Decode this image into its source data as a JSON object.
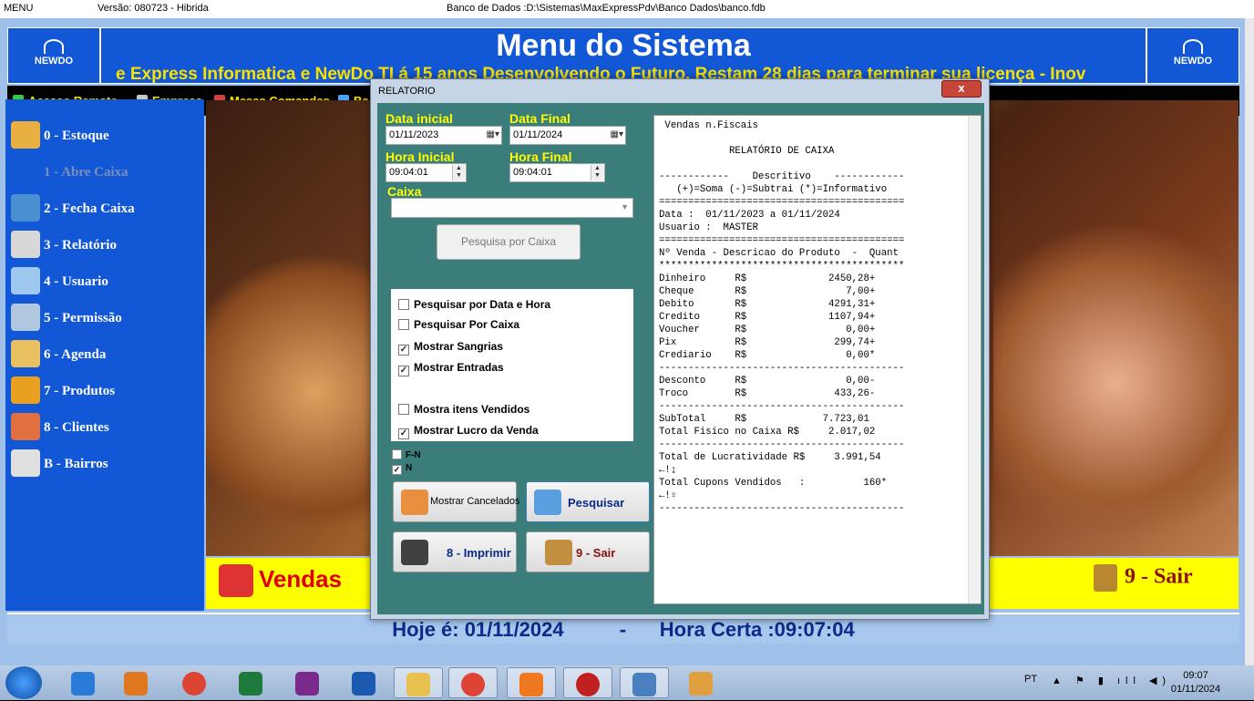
{
  "titlebar": {
    "app": "MENU",
    "version": "Versão: 080723 - Hibrida",
    "database": "Banco de Dados :D:\\Sistemas\\MaxExpressPdv\\Banco Dados\\banco.fdb"
  },
  "header": {
    "logo_left": "NEWDO",
    "logo_right": "NEWDO",
    "title": "Menu do Sistema",
    "marquee": "e Express Informatica e NewDo TI á  15 anos Desenvolvendo o Futuro. Restam 28 dias para terminar sua licença     -    Inov"
  },
  "toolbar": {
    "items": [
      "Acesso Remoto",
      "Empresa",
      "Mesas Comandas",
      "Ba"
    ]
  },
  "sidebar": {
    "items": [
      {
        "label": "0  -  Estoque",
        "icon": "magnifier-box-icon"
      },
      {
        "label": "1  - Abre Caixa",
        "icon": "none"
      },
      {
        "label": "2  - Fecha Caixa",
        "icon": "box-arrow-icon"
      },
      {
        "label": "3  -  Relatório",
        "icon": "printer-icon"
      },
      {
        "label": "4  -  Usuario",
        "icon": "user-card-icon"
      },
      {
        "label": "5  -  Permissão",
        "icon": "user-key-icon"
      },
      {
        "label": "6  -  Agenda",
        "icon": "book-icon"
      },
      {
        "label": "7  -  Produtos",
        "icon": "package-icon"
      },
      {
        "label": "8  -  Clientes",
        "icon": "people-icon"
      },
      {
        "label": "B  -  Bairros",
        "icon": "mailbox-icon"
      }
    ]
  },
  "bottom": {
    "vendas": "Vendas",
    "sair": "9 - Sair"
  },
  "status": {
    "text": "Hoje é: 01/11/2024          -      Hora Certa :09:07:04"
  },
  "dialog": {
    "title": "RELATORIO",
    "close": "x",
    "data_inicial_label": "Data inicial",
    "data_inicial": "01/11/2023",
    "data_final_label": "Data Final",
    "data_final": "01/11/2024",
    "hora_inicial_label": "Hora Inicial",
    "hora_inicial": "09:04:01",
    "hora_final_label": "Hora Final",
    "hora_final": "09:04:01",
    "caixa_label": "Caixa",
    "caixa_value": "",
    "pesquisa_caixa_button": "Pesquisa por Caixa",
    "checks": [
      {
        "label": "Pesquisar por Data e Hora",
        "checked": false
      },
      {
        "label": "Pesquisar Por Caixa",
        "checked": false
      },
      {
        "label": "Mostrar Sangrias",
        "checked": true
      },
      {
        "label": "Mostrar Entradas",
        "checked": true
      },
      {
        "label": "Mostra itens  Vendidos",
        "checked": false
      },
      {
        "label": "Mostrar Lucro da Venda",
        "checked": true
      }
    ],
    "small_checks": [
      {
        "label": "F-N",
        "checked": false
      },
      {
        "label": "N",
        "checked": true
      }
    ],
    "buttons": {
      "cancelados": "Mostrar Cancelados",
      "pesquisar": "Pesquisar",
      "imprimir": "8 - Imprimir",
      "sair": "9 - Sair"
    },
    "report": " Vendas n.Fiscais\n\n            RELATÓRIO DE CAIXA\n\n------------    Descritivo    ------------\n   (+)=Soma (-)=Subtrai (*)=Informativo\n==========================================\nData :  01/11/2023 a 01/11/2024\nUsuario :  MASTER\n==========================================\nNº Venda - Descricao do Produto  -  Quant\n******************************************\nDinheiro     R$              2450,28+\nCheque       R$                 7,00+\nDebito       R$              4291,31+\nCredito      R$              1107,94+\nVoucher      R$                 0,00+\nPix          R$               299,74+\nCrediario    R$                 0,00*\n------------------------------------------\nDesconto     R$                 0,00-\nTroco        R$               433,26-\n------------------------------------------\nSubTotal     R$             7.723,01\nTotal Fisico no Caixa R$     2.017,02\n------------------------------------------\nTotal de Lucratividade R$     3.991,54\n←!↨\nTotal Cupons Vendidos   :          160*\n←!♀\n------------------------------------------"
  },
  "taskbar": {
    "lang": "PT",
    "time": "09:07",
    "date": "01/11/2024"
  },
  "colors": {
    "header_blue": "#1257d6",
    "marquee_yellow": "#f8e100",
    "dialog_teal": "#3b7d7a",
    "vendas_red": "#e00000",
    "status_navy": "#0c2a8a"
  }
}
